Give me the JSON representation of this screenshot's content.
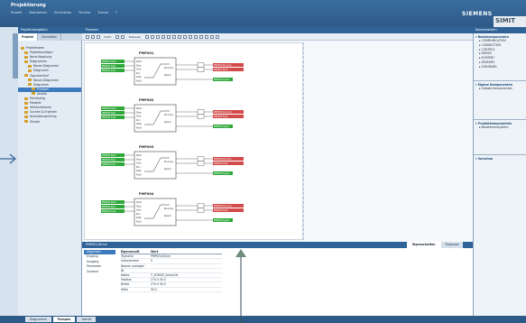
{
  "app": {
    "title": "Projektierung",
    "brand": "SIEMENS",
    "product": "SIMIT",
    "menu": [
      "Projekt",
      "Bearbeiten",
      "Simulation",
      "Fenster",
      "Extras",
      "?"
    ]
  },
  "left_nav": {
    "title": "Projektnavigation",
    "tabs": [
      "Projekt",
      "Simulation"
    ],
    "tree": [
      {
        "label": "Projektname",
        "indent": 0
      },
      {
        "label": "Projektanzeigen",
        "indent": 1
      },
      {
        "label": "Neue Kopplung",
        "indent": 1
      },
      {
        "label": "Diagramme",
        "indent": 1
      },
      {
        "label": "Neues Diagramm",
        "indent": 2
      },
      {
        "label": "Diagramm",
        "indent": 2
      },
      {
        "label": "Signalverlauf",
        "indent": 1
      },
      {
        "label": "Neues Diagramm",
        "indent": 2
      },
      {
        "label": "Diagramm",
        "indent": 2
      },
      {
        "label": "Pumpen",
        "indent": 3,
        "selected": true
      },
      {
        "label": "Ventile",
        "indent": 3
      },
      {
        "label": "Monitoring",
        "indent": 1
      },
      {
        "label": "Modelle",
        "indent": 1
      },
      {
        "label": "Hilfsfunktionen",
        "indent": 1
      },
      {
        "label": "Suchen & Ersetzen",
        "indent": 1
      },
      {
        "label": "Konsistenzprüfung",
        "indent": 1
      },
      {
        "label": "Skripte",
        "indent": 1
      }
    ]
  },
  "editor": {
    "title": "Pumpen",
    "zoom": "100%",
    "zoom_mode": "Teilweise",
    "pumps": [
      {
        "name": "PMP001",
        "left_tags": [
          "PMP001.Start",
          "PMP001.Stop",
          "PMP001.Auto"
        ],
        "right_tags": [
          "PMP001.Running",
          "PMP001.Fault"
        ],
        "extra_tag": "PMP001.Speed"
      },
      {
        "name": "PMP002",
        "left_tags": [
          "PMP002.Start",
          "PMP002.Stop",
          "PMP002.Auto"
        ],
        "right_tags": [
          "PMP002.Running",
          "PMP002.Fault"
        ],
        "extra_tag": "PMP002.Speed"
      },
      {
        "name": "PMP003",
        "left_tags": [
          "PMP003.Start",
          "PMP003.Stop",
          "PMP003.Auto"
        ],
        "right_tags": [
          "PMP003.Running",
          "PMP003.Fault"
        ],
        "extra_tag": "PMP003.Speed"
      },
      {
        "name": "PMP004",
        "left_tags": [
          "PMP004.Start",
          "PMP004.Stop",
          "PMP004.Auto"
        ],
        "right_tags": [
          "PMP004.Running",
          "PMP004.Fault"
        ],
        "extra_tag": "PMP004.Speed"
      }
    ],
    "block_inputs": [
      "Start",
      "Stop",
      "Auto",
      "Run",
      "Setp.",
      "Fault"
    ],
    "block_outputs": [
      "Running",
      "Speed"
    ]
  },
  "properties": {
    "title": "PMP001/Drive",
    "tabs": [
      "Eigenschaften",
      "Diagnose"
    ],
    "nav": [
      "Allgemein",
      "Eingang",
      "Ausgang",
      "Parameter",
      "Zustand"
    ],
    "rows": [
      {
        "key": "Typname",
        "value": "PMP001/Drive"
      },
      {
        "key": "Instanzname",
        "value": "0"
      },
      {
        "key": "Namen anzeigen",
        "value": ""
      },
      {
        "key": "ID",
        "value": ""
      },
      {
        "key": "Makro",
        "value": "T_2DRIVE_Drive10k"
      },
      {
        "key": "Position",
        "value": "270.0  50.0"
      },
      {
        "key": "Breite",
        "value": "270.0  90.0"
      },
      {
        "key": "Höhe",
        "value": "90.0"
      }
    ],
    "header_key": "Eigenschaft",
    "header_value": "Wert"
  },
  "right_pane": {
    "title": "Komponenten",
    "sections": [
      {
        "label": "Basiskomponenten",
        "items": [
          "COMMUNICATION",
          "CONNECTORS",
          "CONTROL",
          "DRIVES",
          "ELEMENT",
          "SENSORS",
          "STANDARD"
        ]
      },
      {
        "label": "Eigene Komponenten",
        "items": [
          "Globale Komponenten"
        ]
      },
      {
        "label": "Projektkomponenten",
        "items": [
          "Bauelementsystem"
        ]
      },
      {
        "label": "Vorschau",
        "items": []
      }
    ]
  },
  "bottom_tabs": [
    "Diagramme",
    "Pumpen",
    "Ventile"
  ],
  "colors": {
    "header_blue": "#2f6398",
    "tag_green": "#2fa83a",
    "tag_red": "#d24a4a",
    "arrow_blue": "#2f6398"
  }
}
